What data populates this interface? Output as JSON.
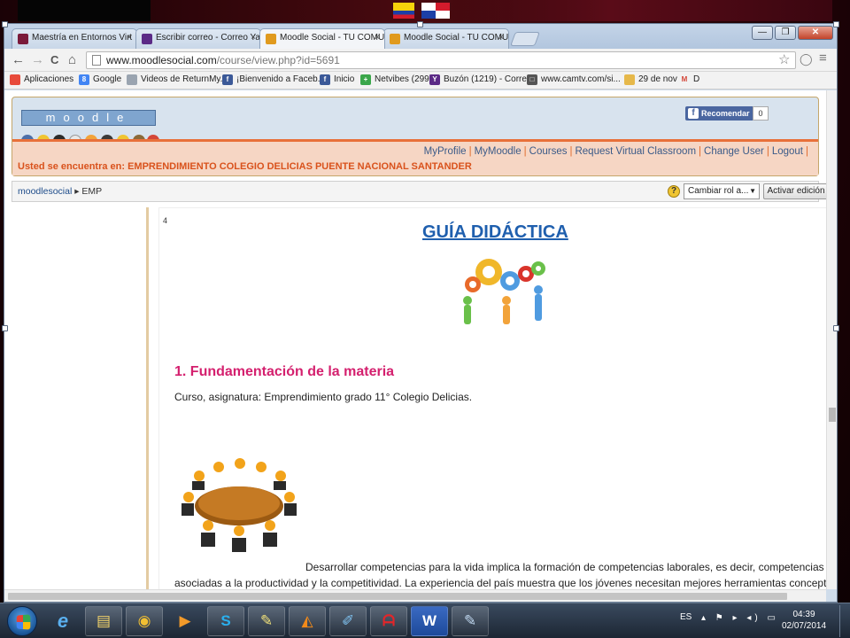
{
  "tabs": [
    {
      "label": "Maestría en Entornos Virt",
      "fav_color": "#7a1a3a"
    },
    {
      "label": "Escribir correo - Correo Ya",
      "fav_color": "#5b2a86"
    },
    {
      "label": "Moodle Social - TU COMU",
      "fav_color": "#e09a1e",
      "active": true
    },
    {
      "label": "Moodle Social - TU COMU",
      "fav_color": "#e09a1e"
    }
  ],
  "tab_close": "×",
  "window_controls": {
    "min": "—",
    "max": "❐",
    "close": "✕"
  },
  "nav": {
    "back": "←",
    "forward": "→",
    "reload": "C",
    "home": "⌂"
  },
  "address": {
    "domain": "www.moodlesocial.com",
    "path": "/course/view.php?id=5691"
  },
  "toolbar_icons": {
    "star": "☆",
    "extra": "◯",
    "menu": "≡"
  },
  "bookmarks": [
    {
      "label": "Aplicaciones",
      "icon_color": "#e84a3a"
    },
    {
      "label": "Google",
      "icon_color": "#4285f4",
      "glyph": "8"
    },
    {
      "label": "Videos de ReturnMy...",
      "icon_color": "#9aa4b0"
    },
    {
      "label": "¡Bienvenido a Faceb...",
      "icon_color": "#3b5998",
      "glyph": "f"
    },
    {
      "label": "Inicio",
      "icon_color": "#3b5998",
      "glyph": "f"
    },
    {
      "label": "Netvibes (299)",
      "icon_color": "#3aa64a",
      "glyph": "+"
    },
    {
      "label": "Buzón (1219) - Corre...",
      "icon_color": "#5b2a86",
      "glyph": "Y"
    },
    {
      "label": "www.camtv.com/si...",
      "icon_color": "#555555",
      "glyph": "□"
    },
    {
      "label": "29 de nov",
      "icon_color": "#e6b84a"
    },
    {
      "label": "D",
      "icon_color": "#d44638",
      "glyph": "M"
    }
  ],
  "moodle": {
    "logo_text": "moodle",
    "fb_like": "Recomendar",
    "fb_count": "0",
    "nav_links": [
      "MyProfile",
      "MyMoodle",
      "Courses",
      "Request Virtual Classroom",
      "Change User",
      "Logout"
    ],
    "location": "Usted se encuentra en: EMPRENDIMIENTO COLEGIO DELICIAS PUENTE NACIONAL SANTANDER"
  },
  "breadcrumb": {
    "home": "moodlesocial",
    "sep": "▸",
    "current": "EMP"
  },
  "help_glyph": "?",
  "role_select": {
    "value": "Cambiar rol a...",
    "arrow": "▼"
  },
  "edit_button": "Activar edición",
  "document": {
    "page_number": "4",
    "title": "GUÍA DIDÁCTICA",
    "heading": "1. Fundamentación de la materia",
    "course_line": "Curso, asignatura: Emprendimiento grado 11° Colegio Delicias.",
    "paragraph_line1": "Desarrollar competencias para la vida implica la formación de competencias laborales, es decir, competencias",
    "paragraph_line2": "asociadas a la productividad y la competitividad. La experiencia del país muestra que los jóvenes necesitan mejores herramientas conceptuales"
  },
  "taskbar": {
    "apps": [
      {
        "name": "ie",
        "glyph": "e"
      },
      {
        "name": "explorer",
        "glyph": "▤"
      },
      {
        "name": "chrome",
        "glyph": "◉"
      },
      {
        "name": "media",
        "glyph": "▶"
      },
      {
        "name": "skype",
        "glyph": "S"
      },
      {
        "name": "notes",
        "glyph": "✎"
      },
      {
        "name": "vlc",
        "glyph": "◭"
      },
      {
        "name": "paint",
        "glyph": "✐"
      },
      {
        "name": "acrobat",
        "glyph": "ᗩ"
      },
      {
        "name": "word",
        "glyph": "W"
      },
      {
        "name": "paintbrush",
        "glyph": "✎"
      }
    ],
    "lang": "ES",
    "tray_icons": "▴ ⚑ ▸ ◂) ▭",
    "time": "04:39",
    "date": "02/07/2014"
  }
}
